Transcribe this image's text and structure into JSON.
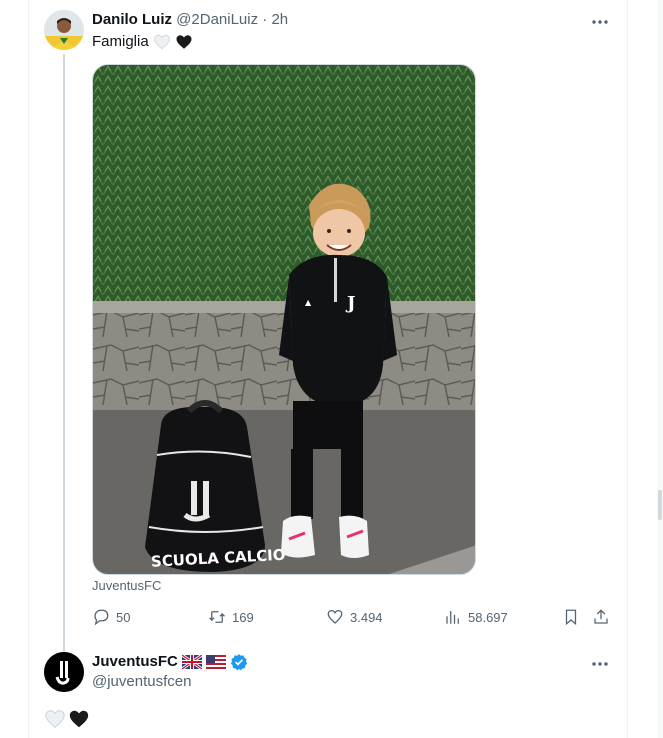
{
  "tweet": {
    "author_name": "Danilo Luiz",
    "author_handle": "@2DaniLuiz",
    "separator": "·",
    "timestamp": "2h",
    "text": "Famiglia",
    "emojis": [
      "white-heart-icon",
      "black-heart-icon"
    ],
    "media_source": "JuventusFC",
    "media_description_text": "SCUOLA CALCIO",
    "stats": {
      "replies": "50",
      "retweets": "169",
      "likes": "3.494",
      "views": "58.697"
    }
  },
  "reply": {
    "author_name": "JuventusFC",
    "flags": [
      "uk-flag-icon",
      "us-flag-icon"
    ],
    "verified": true,
    "author_handle": "@juventusfcen",
    "emojis": [
      "white-heart-icon",
      "black-heart-icon"
    ]
  },
  "colors": {
    "text_primary": "#0f1419",
    "text_secondary": "#536471",
    "verified_blue": "#1d9bf0",
    "thread_line": "#cfd9de"
  }
}
